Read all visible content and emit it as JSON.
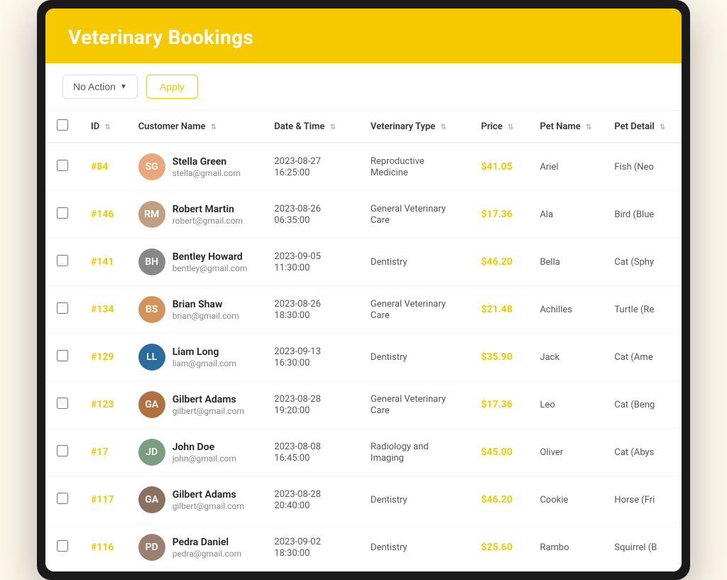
{
  "header": {
    "title": "Veterinary Bookings"
  },
  "toolbar": {
    "no_action_label": "No Action",
    "apply_label": "Apply"
  },
  "table": {
    "columns": [
      {
        "key": "checkbox",
        "label": ""
      },
      {
        "key": "id",
        "label": "ID"
      },
      {
        "key": "customer_name",
        "label": "Customer Name"
      },
      {
        "key": "datetime",
        "label": "Date & Time"
      },
      {
        "key": "vet_type",
        "label": "Veterinary Type"
      },
      {
        "key": "price",
        "label": "Price"
      },
      {
        "key": "pet_name",
        "label": "Pet Name"
      },
      {
        "key": "pet_detail",
        "label": "Pet Detail"
      }
    ],
    "rows": [
      {
        "id": "#84",
        "customer_name": "Stella Green",
        "email": "stella@gmail.com",
        "datetime": "2023-08-27 16:25:00",
        "vet_type": "Reproductive Medicine",
        "price": "$41.05",
        "pet_name": "Ariel",
        "pet_detail": "Fish (Neo",
        "avatar_color": "#e8a87c",
        "avatar_initials": "SG"
      },
      {
        "id": "#146",
        "customer_name": "Robert Martin",
        "email": "robert@gmail.com",
        "datetime": "2023-08-26 06:35:00",
        "vet_type": "General Veterinary Care",
        "price": "$17.36",
        "pet_name": "Ala",
        "pet_detail": "Bird (Blue",
        "avatar_color": "#c0a080",
        "avatar_initials": "RM"
      },
      {
        "id": "#141",
        "customer_name": "Bentley Howard",
        "email": "bentley@gmail.com",
        "datetime": "2023-09-05 11:30:00",
        "vet_type": "Dentistry",
        "price": "$46.20",
        "pet_name": "Bella",
        "pet_detail": "Cat (Sphy",
        "avatar_color": "#888",
        "avatar_initials": "BH"
      },
      {
        "id": "#134",
        "customer_name": "Brian Shaw",
        "email": "brian@gmail.com",
        "datetime": "2023-08-26 18:30:00",
        "vet_type": "General Veterinary Care",
        "price": "$21.48",
        "pet_name": "Achilles",
        "pet_detail": "Turtle (Re",
        "avatar_color": "#d4935a",
        "avatar_initials": "BS"
      },
      {
        "id": "#129",
        "customer_name": "Liam Long",
        "email": "liam@gmail.com",
        "datetime": "2023-09-13 16:30:00",
        "vet_type": "Dentistry",
        "price": "$35.90",
        "pet_name": "Jack",
        "pet_detail": "Cat (Ame",
        "avatar_color": "#2c6b9e",
        "avatar_initials": "LL"
      },
      {
        "id": "#123",
        "customer_name": "Gilbert Adams",
        "email": "gilbert@gmail.com",
        "datetime": "2023-08-28 19:20:00",
        "vet_type": "General Veterinary Care",
        "price": "$17.36",
        "pet_name": "Leo",
        "pet_detail": "Cat (Beng",
        "avatar_color": "#b07040",
        "avatar_initials": "GA"
      },
      {
        "id": "#17",
        "customer_name": "John Doe",
        "email": "john@gmail.com",
        "datetime": "2023-08-08 16:45:00",
        "vet_type": "Radiology and Imaging",
        "price": "$45.00",
        "pet_name": "Oliver",
        "pet_detail": "Cat (Abys",
        "avatar_color": "#7a9e7e",
        "avatar_initials": "JD"
      },
      {
        "id": "#117",
        "customer_name": "Gilbert Adams",
        "email": "gilbert@gmail.com",
        "datetime": "2023-08-28 20:40:00",
        "vet_type": "Dentistry",
        "price": "$46.20",
        "pet_name": "Cookie",
        "pet_detail": "Horse (Fri",
        "avatar_color": "#8a7060",
        "avatar_initials": "GA"
      },
      {
        "id": "#116",
        "customer_name": "Pedra Daniel",
        "email": "pedra@gmail.com",
        "datetime": "2023-09-02 18:30:00",
        "vet_type": "Dentistry",
        "price": "$25.60",
        "pet_name": "Rambo",
        "pet_detail": "Squirrel (B",
        "avatar_color": "#9a8070",
        "avatar_initials": "PD"
      }
    ]
  }
}
